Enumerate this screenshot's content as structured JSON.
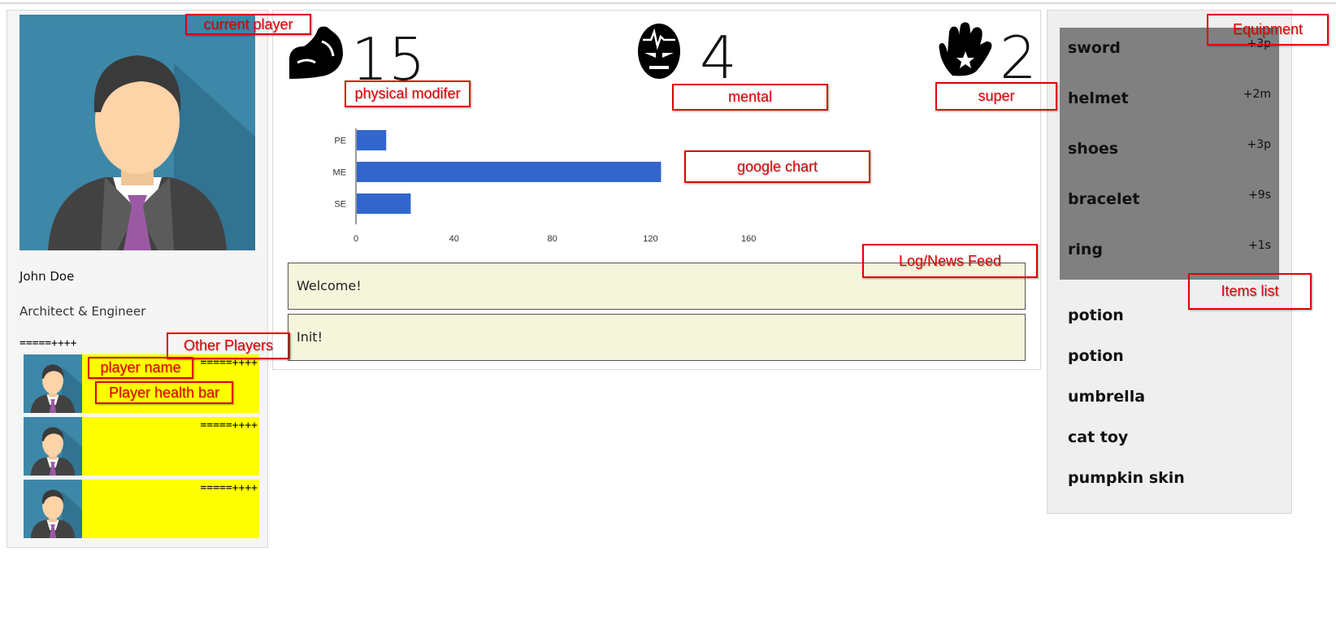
{
  "current_player": {
    "name": "John Doe",
    "role": "Architect & Engineer",
    "health": "=====++++"
  },
  "other_players": [
    {
      "name": "",
      "health": "=====++++"
    },
    {
      "name": "",
      "health": "=====++++"
    },
    {
      "name": "",
      "health": "=====++++"
    }
  ],
  "stats": {
    "physical": {
      "icon": "muscle-arm-icon",
      "value": "15"
    },
    "mental": {
      "icon": "brain-mask-icon",
      "value": "4"
    },
    "super": {
      "icon": "burst-hand-icon",
      "value": "2"
    }
  },
  "chart_data": {
    "type": "bar",
    "orientation": "horizontal",
    "categories": [
      "PE",
      "ME",
      "SE"
    ],
    "values": [
      12,
      124,
      22
    ],
    "xticks": [
      "0",
      "40",
      "80",
      "120",
      "160"
    ],
    "xlim": [
      0,
      160
    ],
    "color": "#3366cc",
    "grid": false,
    "legend": "none"
  },
  "feed": [
    {
      "text": "Welcome!"
    },
    {
      "text": "Init!"
    }
  ],
  "equipment": [
    {
      "name": "sword",
      "mod": "+3p"
    },
    {
      "name": "helmet",
      "mod": "+2m"
    },
    {
      "name": "shoes",
      "mod": "+3p"
    },
    {
      "name": "bracelet",
      "mod": "+9s"
    },
    {
      "name": "ring",
      "mod": "+1s"
    }
  ],
  "items": [
    "potion",
    "potion",
    "umbrella",
    "cat toy",
    "pumpkin skin"
  ],
  "annotations": {
    "current_player": "current player",
    "physical": "physical modifer",
    "mental": "mental",
    "super": "super",
    "chart": "google chart",
    "feed": "Log/News Feed",
    "equipment": "Equipment",
    "items": "Items list",
    "other_players": "Other Players",
    "player_name": "player name",
    "health_bar": "Player health bar"
  },
  "colors": {
    "accent_bar": "#3366cc",
    "other_player_bg": "#ffff00",
    "feed_bg": "#f5f5dc",
    "equipment_bg": "#808080",
    "annotation": "#e00000"
  }
}
